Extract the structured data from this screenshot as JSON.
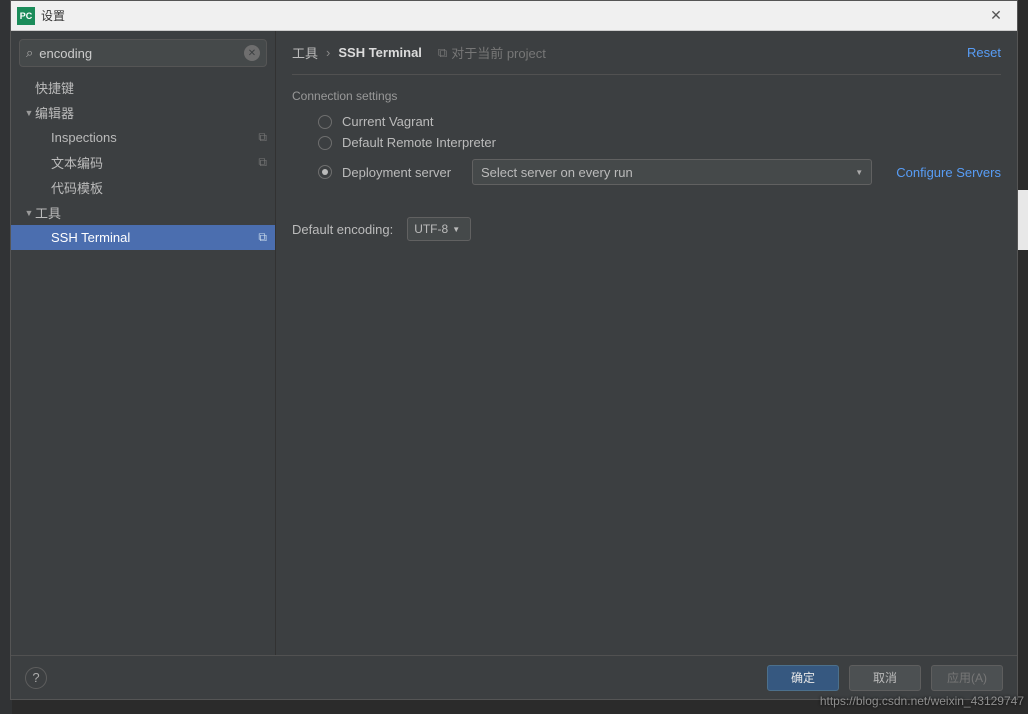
{
  "titlebar": {
    "icon_text": "PC",
    "title": "设置",
    "close_glyph": "✕"
  },
  "search": {
    "icon_glyph": "⌕",
    "value": "encoding",
    "clear_glyph": "✕"
  },
  "tree": {
    "items": [
      {
        "label": "快捷键",
        "level": 0,
        "expandable": false,
        "selected": false,
        "copy": false
      },
      {
        "label": "编辑器",
        "level": 0,
        "expandable": true,
        "arrow": "▼",
        "selected": false,
        "copy": false
      },
      {
        "label": "Inspections",
        "level": 1,
        "expandable": false,
        "selected": false,
        "copy": true
      },
      {
        "label": "文本编码",
        "level": 1,
        "expandable": false,
        "selected": false,
        "copy": true
      },
      {
        "label": "代码模板",
        "level": 1,
        "expandable": false,
        "selected": false,
        "copy": false
      },
      {
        "label": "工具",
        "level": 0,
        "expandable": true,
        "arrow": "▼",
        "selected": false,
        "copy": false
      },
      {
        "label": "SSH Terminal",
        "level": 1,
        "expandable": false,
        "selected": true,
        "copy": true
      }
    ]
  },
  "breadcrumb": {
    "part1": "工具",
    "sep": "›",
    "part2": "SSH Terminal",
    "hint_icon": "⧉",
    "hint": "对于当前 project",
    "reset": "Reset"
  },
  "settings": {
    "connection_title": "Connection settings",
    "radio_vagrant": "Current Vagrant",
    "radio_remote": "Default Remote Interpreter",
    "radio_deploy": "Deployment server",
    "deploy_dropdown": "Select server on every run",
    "configure_link": "Configure Servers",
    "encoding_label": "Default encoding:",
    "encoding_value": "UTF-8"
  },
  "footer": {
    "help_glyph": "?",
    "ok": "确定",
    "cancel": "取消",
    "apply": "应用(A)"
  },
  "watermark": "https://blog.csdn.net/weixin_43129747"
}
